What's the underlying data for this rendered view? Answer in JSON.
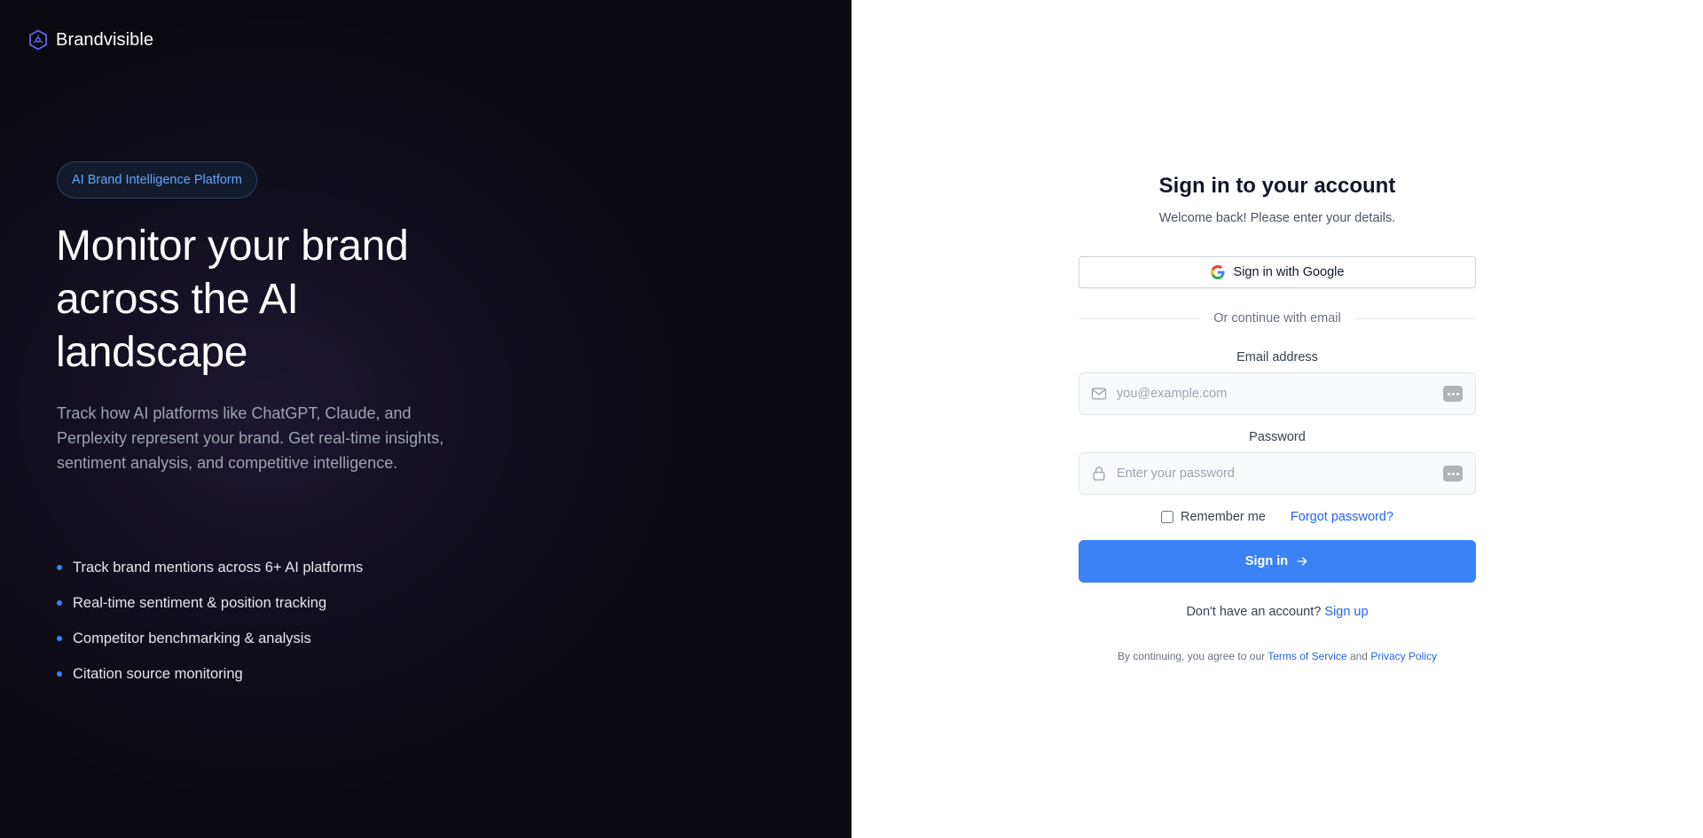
{
  "brand": {
    "name": "Brandvisible",
    "logo_icon": "hexagon-logo-icon"
  },
  "hero": {
    "badge": "AI Brand Intelligence Platform",
    "title_line1": "Monitor your brand",
    "title_line2": "across the AI",
    "title_line3": "landscape",
    "description": "Track how AI platforms like ChatGPT, Claude, and Perplexity represent your brand. Get real-time insights, sentiment analysis, and competitive intelligence.",
    "features": [
      "Track brand mentions across 6+ AI platforms",
      "Real-time sentiment & position tracking",
      "Competitor benchmarking & analysis",
      "Citation source monitoring"
    ]
  },
  "form": {
    "title": "Sign in to your account",
    "subtitle": "Welcome back! Please enter your details.",
    "google_label": "Sign in with Google",
    "divider": "Or continue with email",
    "email_label": "Email address",
    "email_placeholder": "you@example.com",
    "password_label": "Password",
    "password_placeholder": "Enter your password",
    "remember_label": "Remember me",
    "forgot_label": "Forgot password?",
    "submit_label": "Sign in",
    "no_account_text": "Don't have an account?",
    "signup_label": "Sign up",
    "legal_prefix": "By continuing, you agree to our",
    "terms_label": "Terms of Service",
    "legal_and": "and",
    "privacy_label": "Privacy Policy"
  },
  "colors": {
    "accent": "#3b82f6",
    "link": "#2563eb",
    "left_panel_bg": "#0b0a10",
    "badge_text": "#60a5fa"
  }
}
